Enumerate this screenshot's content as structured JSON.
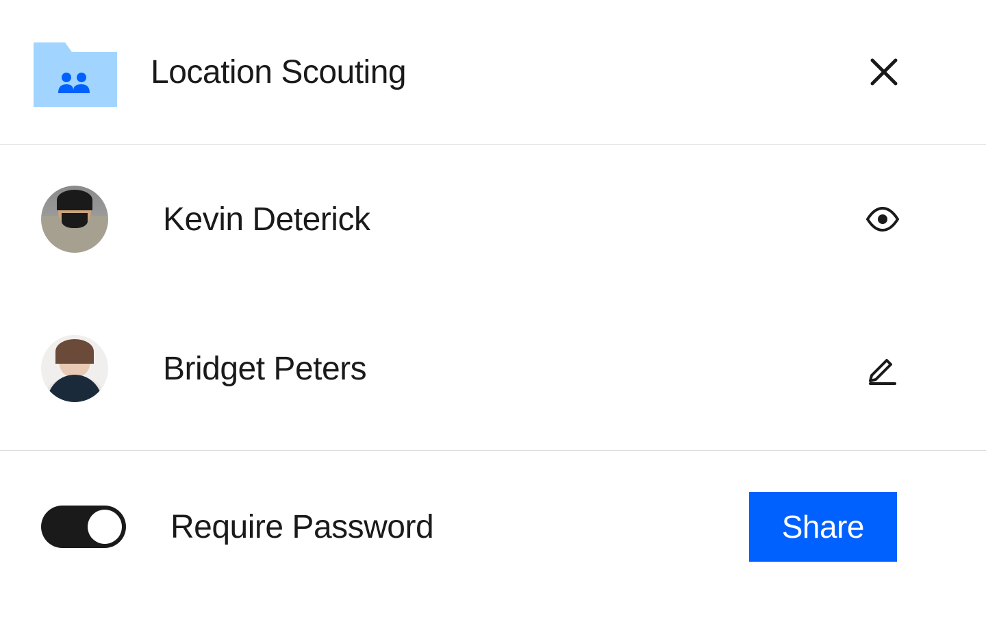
{
  "header": {
    "title": "Location Scouting"
  },
  "users": [
    {
      "name": "Kevin Deterick",
      "permission": "view"
    },
    {
      "name": "Bridget Peters",
      "permission": "edit"
    }
  ],
  "footer": {
    "toggle_label": "Require Password",
    "toggle_state": "on",
    "share_label": "Share"
  }
}
